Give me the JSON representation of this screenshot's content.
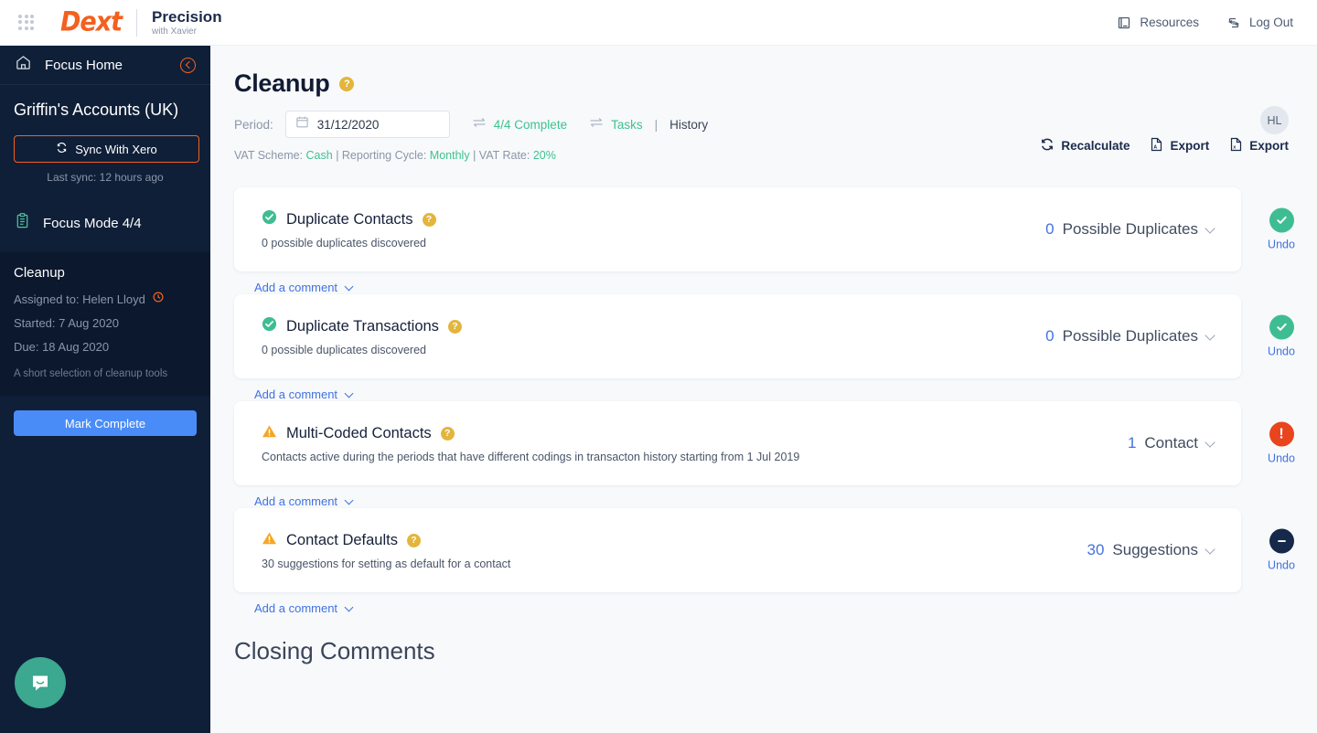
{
  "topbar": {
    "grid_icon": "apps-grid-icon",
    "logo": "Dext",
    "product": "Precision",
    "product_sub": "with Xavier",
    "resources_label": "Resources",
    "resources_icon": "book-icon",
    "logout_label": "Log Out",
    "logout_icon": "logout-icon"
  },
  "sidebar": {
    "focus_home": "Focus Home",
    "home_icon": "home-icon",
    "collapse_icon": "chevron-left-circle-icon",
    "account_name": "Griffin's Accounts (UK)",
    "sync_button": "Sync With Xero",
    "sync_icon": "refresh-icon",
    "last_sync": "Last sync: 12 hours ago",
    "focus_mode": "Focus Mode 4/4",
    "focus_mode_icon": "clipboard-icon",
    "task": {
      "title": "Cleanup",
      "assigned": "Assigned to: Helen Lloyd",
      "assigned_icon": "clock-icon",
      "started": "Started: 7 Aug 2020",
      "due": "Due: 18 Aug 2020",
      "description": "A short selection of cleanup tools"
    },
    "mark_complete": "Mark Complete",
    "chat_icon": "intercom-chat-icon"
  },
  "main": {
    "page_title": "Cleanup",
    "page_title_help": "?",
    "avatar_initials": "HL",
    "period_label": "Period:",
    "period_value": "31/12/2020",
    "calendar_icon": "calendar-icon",
    "complete_chip": "4/4 Complete",
    "complete_chip_icon": "swap-icon",
    "tabs_icon": "swap-icon",
    "tab_tasks": "Tasks",
    "tab_separator": "|",
    "tab_history": "History",
    "vat_scheme_label": "VAT Scheme:",
    "vat_scheme_value": "Cash",
    "reporting_cycle_label": "| Reporting Cycle:",
    "reporting_cycle_value": "Monthly",
    "vat_rate_label": "| VAT Rate:",
    "vat_rate_value": "20%",
    "actions": [
      {
        "label": "Recalculate",
        "icon": "recalculate-icon"
      },
      {
        "label": "Export",
        "icon": "pdf-file-icon"
      },
      {
        "label": "Export",
        "icon": "excel-file-icon"
      }
    ],
    "comment_label": "Add a comment",
    "undo_label": "Undo",
    "closing_comments": "Closing Comments",
    "cards": [
      {
        "title": "Duplicate Contacts",
        "help": "?",
        "subtitle": "0 possible duplicates discovered",
        "status": "ok",
        "status_icon": "check-circle-icon",
        "count": "0",
        "unit": "Possible Duplicates"
      },
      {
        "title": "Duplicate Transactions",
        "help": "?",
        "subtitle": "0 possible duplicates discovered",
        "status": "ok",
        "status_icon": "check-circle-icon",
        "count": "0",
        "unit": "Possible Duplicates"
      },
      {
        "title": "Multi-Coded Contacts",
        "help": "?",
        "subtitle": "Contacts active during the periods that have different codings in transacton history starting from 1 Jul 2019",
        "status": "warning",
        "status_icon": "exclamation-circle-icon",
        "count": "1",
        "unit": "Contact"
      },
      {
        "title": "Contact Defaults",
        "help": "?",
        "subtitle": "30 suggestions for setting as default for a contact",
        "status": "neutral",
        "status_icon": "minus-circle-icon",
        "count": "30",
        "unit": "Suggestions"
      }
    ]
  },
  "colors": {
    "brand_orange": "#f4601e",
    "navy": "#101f38",
    "green": "#3ec28f",
    "blue_link": "#4272e0",
    "yellow_badge": "#e3b53c",
    "red": "#e8441d"
  }
}
